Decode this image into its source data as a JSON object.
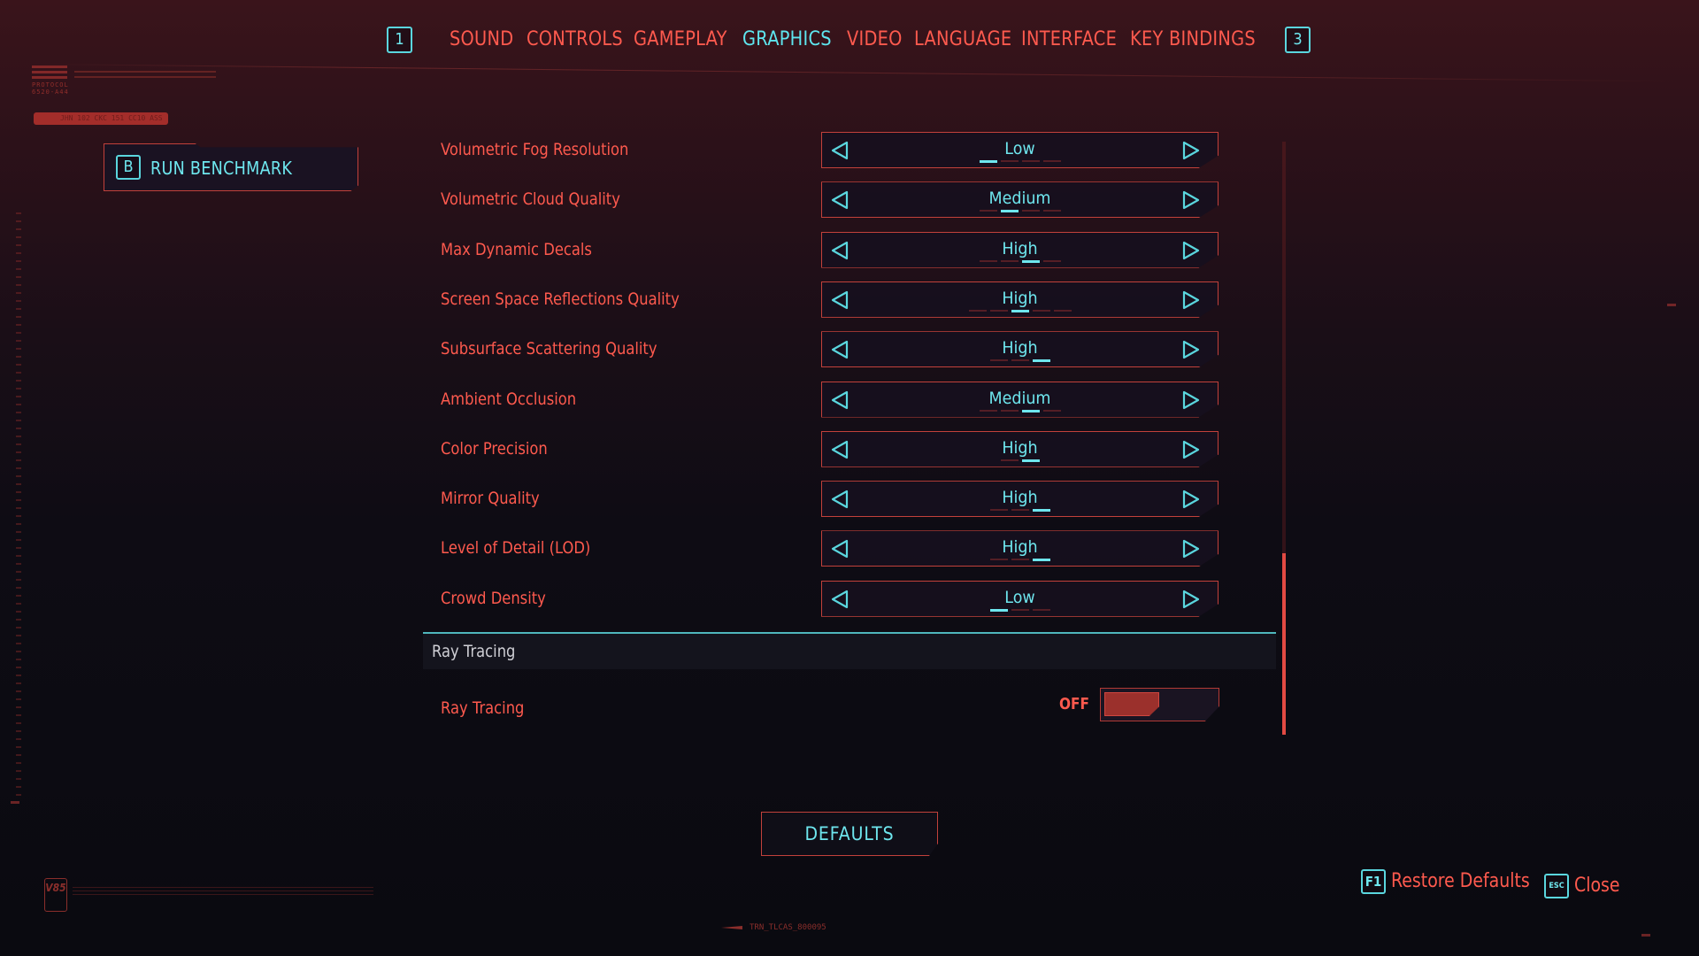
{
  "tabs": {
    "prev_key": "1",
    "next_key": "3",
    "items": [
      {
        "label": "SOUND",
        "active": false
      },
      {
        "label": "CONTROLS",
        "active": false
      },
      {
        "label": "GAMEPLAY",
        "active": false
      },
      {
        "label": "GRAPHICS",
        "active": true
      },
      {
        "label": "VIDEO",
        "active": false
      },
      {
        "label": "LANGUAGE",
        "active": false
      },
      {
        "label": "INTERFACE",
        "active": false
      },
      {
        "label": "KEY BINDINGS",
        "active": false
      }
    ]
  },
  "decor": {
    "protocol_label": "PROTOCOL",
    "protocol_code": "6520-A44",
    "code_pill": "JHN 102 CKC 151 CC10 ASS",
    "version_badge": "V85",
    "trn_code": "TRN_TLCAS_800095"
  },
  "benchmark": {
    "key": "B",
    "label": "RUN BENCHMARK"
  },
  "settings": [
    {
      "label": "Volumetric Fog Resolution",
      "value": "Low",
      "position": 1,
      "steps": 4
    },
    {
      "label": "Volumetric Cloud Quality",
      "value": "Medium",
      "position": 2,
      "steps": 4
    },
    {
      "label": "Max Dynamic Decals",
      "value": "High",
      "position": 3,
      "steps": 4
    },
    {
      "label": "Screen Space Reflections Quality",
      "value": "High",
      "position": 3,
      "steps": 5
    },
    {
      "label": "Subsurface Scattering Quality",
      "value": "High",
      "position": 3,
      "steps": 3
    },
    {
      "label": "Ambient Occlusion",
      "value": "Medium",
      "position": 3,
      "steps": 4
    },
    {
      "label": "Color Precision",
      "value": "High",
      "position": 2,
      "steps": 2
    },
    {
      "label": "Mirror Quality",
      "value": "High",
      "position": 3,
      "steps": 3
    },
    {
      "label": "Level of Detail (LOD)",
      "value": "High",
      "position": 3,
      "steps": 3
    },
    {
      "label": "Crowd Density",
      "value": "Low",
      "position": 1,
      "steps": 3
    }
  ],
  "ray_tracing_section": {
    "title": "Ray Tracing",
    "toggle_label": "Ray Tracing",
    "toggle_state": "OFF",
    "enabled": false
  },
  "defaults_button": "DEFAULTS",
  "footer": {
    "restore_key": "F1",
    "restore_label": "Restore Defaults",
    "close_key": "ESC",
    "close_label": "Close"
  },
  "colors": {
    "accent_cyan": "#5ee6ef",
    "accent_red": "#ff5a4e",
    "border_red": "#c2413b"
  }
}
